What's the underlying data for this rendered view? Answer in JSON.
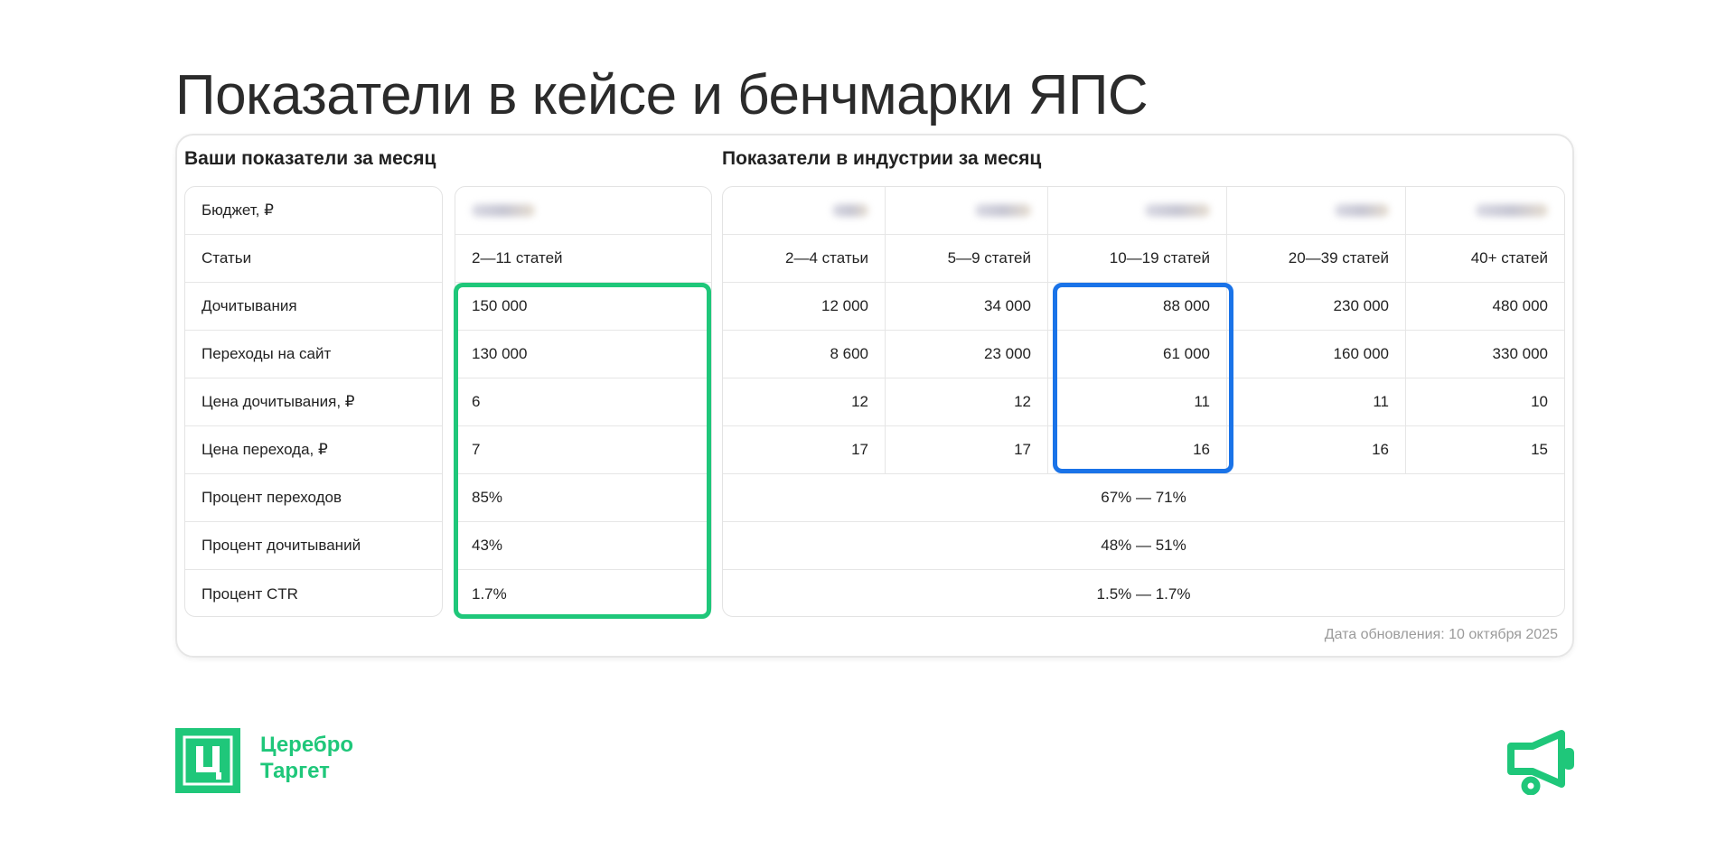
{
  "title": "Показатели в кейсе и бенчмарки ЯПС",
  "left_section_title": "Ваши показатели за месяц",
  "right_section_title": "Показатели в индустрии за месяц",
  "your_metrics": [
    {
      "label": "Бюджет, ₽",
      "value": null,
      "blurred": true
    },
    {
      "label": "Статьи",
      "value": "2—11 статей"
    },
    {
      "label": "Дочитывания",
      "value": "150 000"
    },
    {
      "label": "Переходы на сайт",
      "value": "130 000"
    },
    {
      "label": "Цена дочитывания, ₽",
      "value": "6"
    },
    {
      "label": "Цена перехода, ₽",
      "value": "7"
    },
    {
      "label": "Процент переходов",
      "value": "85%"
    },
    {
      "label": "Процент дочитываний",
      "value": "43%"
    },
    {
      "label": "Процент CTR",
      "value": "1.7%"
    }
  ],
  "industry": {
    "columns": [
      "2—4 статьи",
      "5—9 статей",
      "10—19 статей",
      "20—39 статей",
      "40+ статей"
    ],
    "rows": [
      [
        "12 000",
        "34 000",
        "88 000",
        "230 000",
        "480 000"
      ],
      [
        "8 600",
        "23 000",
        "61 000",
        "160 000",
        "330 000"
      ],
      [
        "12",
        "12",
        "11",
        "11",
        "10"
      ],
      [
        "17",
        "17",
        "16",
        "16",
        "15"
      ]
    ],
    "merged_rows": [
      "67% — 71%",
      "48% — 51%",
      "1.5% — 1.7%"
    ]
  },
  "update_date": "Дата обновления: 10 октября 2025",
  "brand": {
    "logo_letter": "Ц",
    "name_line1": "Церебро",
    "name_line2": "Таргет",
    "color": "#1fc77a"
  },
  "highlight_colors": {
    "yours": "#1fc77a",
    "industry": "#1a73e8"
  },
  "icons": [
    "megaphone-icon"
  ]
}
